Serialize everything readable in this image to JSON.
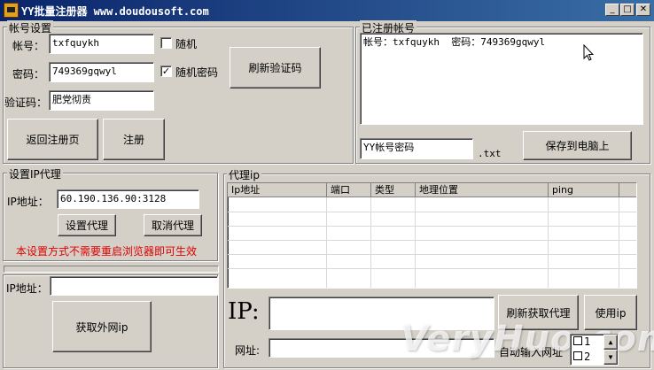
{
  "window": {
    "title": "YY批量注册器 www.doudousoft.com",
    "controls": [
      "minimize",
      "maximize",
      "close"
    ]
  },
  "account": {
    "legend": "帐号设置",
    "account_label": "帐号：",
    "account_value": "txfquykh",
    "random_label": "随机",
    "random_checked": false,
    "password_label": "密码：",
    "password_value": "749369gqwyl",
    "random_password_label": "随机密码",
    "random_password_checked": true,
    "captcha_label": "验证码：",
    "captcha_value": "肥党彻责",
    "refresh_captcha_label": "刷新验证码",
    "back_label": "返回注册页",
    "register_label": "注册"
  },
  "registered": {
    "legend": "已注册帐号",
    "content": "帐号：txfquykh  密码：749369gqwyl",
    "filename_value": "YY帐号密码",
    "extension": ".txt",
    "save_label": "保存到电脑上"
  },
  "proxy_settings": {
    "legend": "设置IP代理",
    "ip_label": "IP地址：",
    "ip_value": "60.190.136.90:3128",
    "set_label": "设置代理",
    "cancel_label": "取消代理",
    "notice": "本设置方式不需要重启浏览器即可生效"
  },
  "external": {
    "ip_label": "IP地址：",
    "ip_value": "",
    "get_label": "获取外网ip"
  },
  "proxy_list": {
    "legend": "代理ip",
    "columns": [
      "Ip地址",
      "端口",
      "类型",
      "地理位置",
      "ping"
    ],
    "ip_big_label": "IP:",
    "ip_value": "",
    "refresh_label": "刷新获取代理",
    "use_label": "使用ip",
    "url_label": "网址:",
    "url_value": "",
    "auto_input_label": "自动输入网址",
    "spinner_items": [
      "1",
      "2"
    ]
  },
  "watermark": "VeryHuo.com"
}
